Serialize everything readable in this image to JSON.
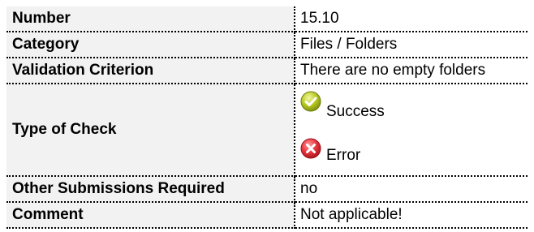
{
  "rows": [
    {
      "key": "Number",
      "value": "15.10"
    },
    {
      "key": "Category",
      "value": "Files / Folders"
    },
    {
      "key": "Validation Criterion",
      "value": "There are no empty folders"
    },
    {
      "key": "Type of Check",
      "checks": [
        {
          "label": "Success",
          "icon": "success-check-icon",
          "color": "#b5c61e"
        },
        {
          "label": "Error",
          "icon": "error-x-icon",
          "color": "#e8363f"
        }
      ]
    },
    {
      "key": "Other Submissions Required",
      "value": "no"
    },
    {
      "key": "Comment",
      "value": "Not applicable!"
    }
  ],
  "colors": {
    "key_background": "#f2f2f2",
    "border": "#000000"
  }
}
